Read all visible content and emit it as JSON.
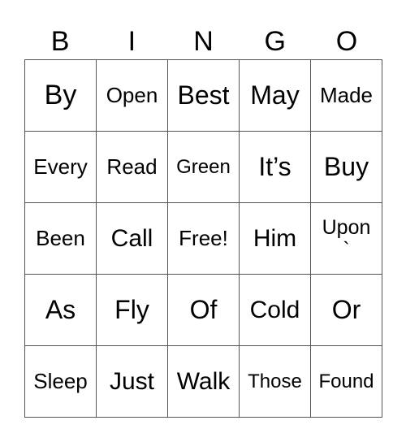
{
  "header": [
    "B",
    "I",
    "N",
    "G",
    "O"
  ],
  "cells": [
    [
      "By",
      "Open",
      "Best",
      "May",
      "Made"
    ],
    [
      "Every",
      "Read",
      "Green",
      "It’s",
      "Buy"
    ],
    [
      "Been",
      "Call",
      "Free!",
      "Him",
      "Upon\n`"
    ],
    [
      "As",
      "Fly",
      "Of",
      "Cold",
      "Or"
    ],
    [
      "Sleep",
      "Just",
      "Walk",
      "Those",
      "Found"
    ]
  ]
}
